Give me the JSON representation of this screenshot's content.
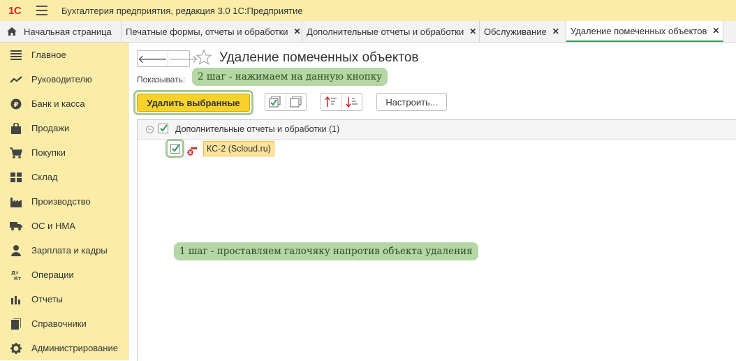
{
  "app": {
    "logo": "1С",
    "title": "Бухгалтерия предприятия, редакция 3.0 1С:Предприятие"
  },
  "tabs": [
    {
      "label": "Начальная страница"
    },
    {
      "label": "Печатные формы, отчеты и обработки"
    },
    {
      "label": "Дополнительные отчеты и обработки"
    },
    {
      "label": "Обслуживание"
    },
    {
      "label": "Удаление помеченных объектов"
    }
  ],
  "sidebar": {
    "items": [
      {
        "label": "Главное",
        "icon": "menu-icon"
      },
      {
        "label": "Руководителю",
        "icon": "trend-icon"
      },
      {
        "label": "Банк и касса",
        "icon": "coin-icon"
      },
      {
        "label": "Продажи",
        "icon": "bag-icon"
      },
      {
        "label": "Покупки",
        "icon": "cart-icon"
      },
      {
        "label": "Склад",
        "icon": "warehouse-icon"
      },
      {
        "label": "Производство",
        "icon": "factory-icon"
      },
      {
        "label": "ОС и НМА",
        "icon": "truck-icon"
      },
      {
        "label": "Зарплата и кадры",
        "icon": "person-icon"
      },
      {
        "label": "Операции",
        "icon": "dt-kt-icon"
      },
      {
        "label": "Отчеты",
        "icon": "bar-chart-icon"
      },
      {
        "label": "Справочники",
        "icon": "book-icon"
      },
      {
        "label": "Администрирование",
        "icon": "gear-icon"
      }
    ]
  },
  "main": {
    "title": "Удаление помеченных объектов",
    "show_label": "Показывать:",
    "delete_button": "Удалить выбранные",
    "setup_button": "Настроить...",
    "tree": {
      "group_label": "Дополнительные отчеты и обработки (1)",
      "item_label": "КС-2 (Scloud.ru)"
    },
    "callouts": {
      "step2": "2 шаг - нажимаем на данную кнопку",
      "step1": "1 шаг - проставляем галочяку напротив объекта удаления"
    }
  },
  "colors": {
    "accent_yellow": "#fbeda8",
    "button_yellow": "#f7d22a",
    "callout_green": "#b5d6a5",
    "check_green": "#2e9e56",
    "logo_red": "#d9262b"
  }
}
